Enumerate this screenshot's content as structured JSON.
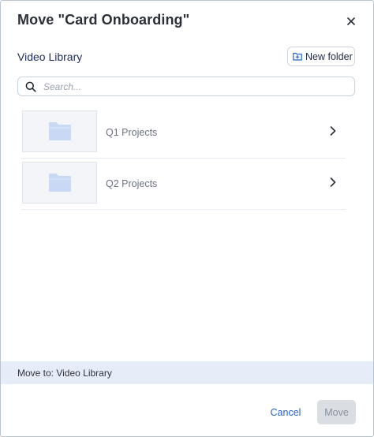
{
  "dialog": {
    "title": "Move \"Card Onboarding\"",
    "close_icon": "close-icon"
  },
  "library": {
    "title": "Video Library",
    "new_folder_label": "New folder",
    "new_folder_icon": "folder-plus-icon"
  },
  "search": {
    "placeholder": "Search...",
    "value": "",
    "icon": "search-icon"
  },
  "folders": [
    {
      "name": "Q1 Projects",
      "icon": "folder-icon"
    },
    {
      "name": "Q2 Projects",
      "icon": "folder-icon"
    }
  ],
  "footer": {
    "move_to_text": "Move to: Video Library",
    "cancel_label": "Cancel",
    "move_label": "Move",
    "move_enabled": false
  },
  "colors": {
    "accent": "#2563c9",
    "folder_icon": "#c9d9f5",
    "move_bar_bg": "#e7edf8",
    "disabled_btn": "#dadde2"
  }
}
